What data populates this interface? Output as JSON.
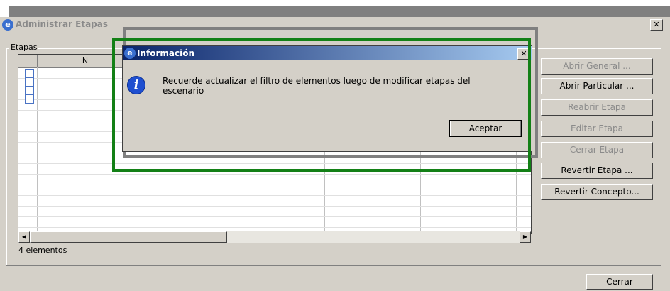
{
  "main_window": {
    "title": "Administrar Etapas",
    "close_glyph": "✕",
    "group_label": "Etapas",
    "grid": {
      "columns": [
        "",
        "N",
        "",
        "",
        "",
        ""
      ],
      "checkbox_rows": 4
    },
    "count_label": "4 elementos",
    "buttons": {
      "abrir_general": "Abrir General ...",
      "abrir_particular": "Abrir Particular ...",
      "reabrir_etapa": "Reabrir Etapa",
      "editar_etapa": "Editar Etapa",
      "cerrar_etapa": "Cerrar Etapa",
      "revertir_etapa": "Revertir Etapa ...",
      "revertir_concepto": "Revertir Concepto...",
      "cerrar": "Cerrar"
    },
    "disabled_buttons": [
      "abrir_general",
      "reabrir_etapa",
      "editar_etapa",
      "cerrar_etapa"
    ]
  },
  "dialog": {
    "title": "Información",
    "close_glyph": "✕",
    "message_line1": "Recuerde actualizar el filtro de elementos luego de modificar etapas del",
    "message_line2": "escenario",
    "ok_label": "Aceptar",
    "info_glyph": "i"
  },
  "icons": {
    "app_icon": "app-logo-icon",
    "info_icon": "information-icon",
    "scroll_left": "◀",
    "scroll_right": "▶"
  },
  "colors": {
    "highlight_green": "#138016",
    "highlight_gray": "#808080",
    "dialog_title_start": "#0a246a",
    "dialog_title_end": "#a6caf0"
  }
}
